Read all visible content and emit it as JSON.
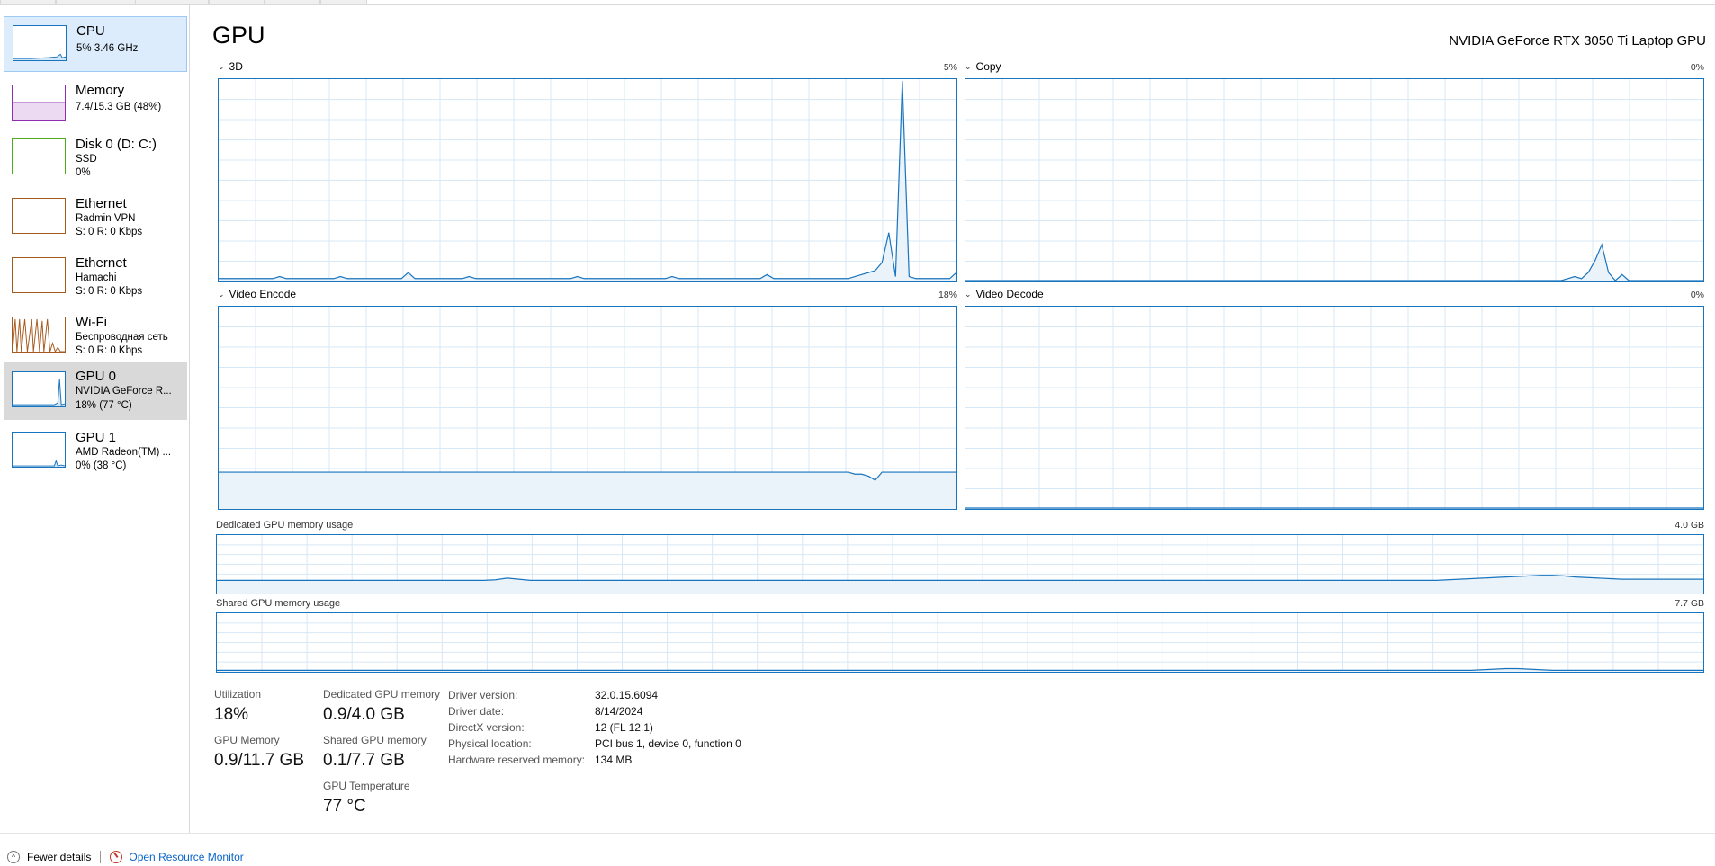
{
  "sidebar": {
    "items": [
      {
        "title": "CPU",
        "sub1": "5% 3.46 GHz",
        "sub2": "",
        "color": "#1874bd"
      },
      {
        "title": "Memory",
        "sub1": "7.4/15.3 GB (48%)",
        "sub2": "",
        "color": "#8e2fb3"
      },
      {
        "title": "Disk 0 (D: C:)",
        "sub1": "SSD",
        "sub2": "0%",
        "color": "#4eab1d"
      },
      {
        "title": "Ethernet",
        "sub1": "Radmin VPN",
        "sub2": "S: 0 R: 0 Kbps",
        "color": "#a75a1e"
      },
      {
        "title": "Ethernet",
        "sub1": "Hamachi",
        "sub2": "S: 0 R: 0 Kbps",
        "color": "#a75a1e"
      },
      {
        "title": "Wi-Fi",
        "sub1": "Беспроводная сеть",
        "sub2": "S: 0 R: 0 Kbps",
        "color": "#a75a1e"
      },
      {
        "title": "GPU 0",
        "sub1": "NVIDIA GeForce R...",
        "sub2": "18% (77 °C)",
        "color": "#1874bd"
      },
      {
        "title": "GPU 1",
        "sub1": "AMD Radeon(TM) ...",
        "sub2": "0% (38 °C)",
        "color": "#1874bd"
      }
    ]
  },
  "header": {
    "title": "GPU",
    "device": "NVIDIA GeForce RTX 3050 Ti Laptop GPU"
  },
  "graphs": {
    "g3d": {
      "label": "3D",
      "pct": "5%"
    },
    "copy": {
      "label": "Copy",
      "pct": "0%"
    },
    "encode": {
      "label": "Video Encode",
      "pct": "18%"
    },
    "decode": {
      "label": "Video Decode",
      "pct": "0%"
    },
    "dedicated": {
      "label": "Dedicated GPU memory usage",
      "max": "4.0 GB"
    },
    "shared": {
      "label": "Shared GPU memory usage",
      "max": "7.7 GB"
    }
  },
  "stats": {
    "utilization_label": "Utilization",
    "utilization": "18%",
    "gpu_memory_label": "GPU Memory",
    "gpu_memory": "0.9/11.7 GB",
    "dedicated_label": "Dedicated GPU memory",
    "dedicated": "0.9/4.0 GB",
    "shared_label": "Shared GPU memory",
    "shared": "0.1/7.7 GB",
    "temp_label": "GPU Temperature",
    "temp": "77 °C"
  },
  "properties": [
    {
      "key": "Driver version:",
      "value": "32.0.15.6094"
    },
    {
      "key": "Driver date:",
      "value": "8/14/2024"
    },
    {
      "key": "DirectX version:",
      "value": "12 (FL 12.1)"
    },
    {
      "key": "Physical location:",
      "value": "PCI bus 1, device 0, function 0"
    },
    {
      "key": "Hardware reserved memory:",
      "value": "134 MB"
    }
  ],
  "footer": {
    "fewer_details": "Fewer details",
    "resource_monitor": "Open Resource Monitor"
  },
  "colors": {
    "accent": "#1874bd",
    "grid": "#d7e8f6",
    "fill": "#eaf2fa"
  },
  "series": {
    "g3d": [
      1,
      1,
      1,
      1,
      1,
      1,
      1,
      1,
      1,
      2,
      1,
      1,
      1,
      1,
      1,
      1,
      1,
      1,
      2,
      1,
      1,
      1,
      1,
      1,
      1,
      1,
      1,
      1,
      4,
      1,
      1,
      1,
      1,
      1,
      1,
      1,
      1,
      2,
      1,
      1,
      1,
      1,
      1,
      1,
      1,
      1,
      1,
      1,
      1,
      1,
      1,
      1,
      1,
      2,
      1,
      1,
      1,
      1,
      1,
      1,
      1,
      1,
      1,
      1,
      1,
      1,
      1,
      2,
      1,
      1,
      1,
      1,
      1,
      1,
      1,
      1,
      1,
      1,
      1,
      1,
      1,
      3,
      1,
      1,
      1,
      1,
      1,
      1,
      1,
      1,
      1,
      1,
      1,
      1,
      2,
      3,
      4,
      5,
      9,
      24,
      2,
      100,
      2,
      1,
      1,
      1,
      1,
      1,
      1,
      4
    ],
    "copy": [
      0,
      0,
      0,
      0,
      0,
      0,
      0,
      0,
      0,
      0,
      0,
      0,
      0,
      0,
      0,
      0,
      0,
      0,
      0,
      0,
      0,
      0,
      0,
      0,
      0,
      0,
      0,
      0,
      0,
      0,
      0,
      0,
      0,
      0,
      0,
      0,
      0,
      0,
      0,
      0,
      0,
      0,
      0,
      0,
      0,
      0,
      0,
      0,
      0,
      0,
      0,
      0,
      0,
      0,
      0,
      0,
      0,
      0,
      0,
      0,
      0,
      0,
      0,
      0,
      0,
      0,
      0,
      0,
      0,
      0,
      0,
      0,
      0,
      0,
      0,
      0,
      0,
      0,
      0,
      0,
      0,
      0,
      0,
      0,
      0,
      0,
      0,
      0,
      0,
      1,
      2,
      1,
      4,
      10,
      18,
      4,
      0,
      3,
      0,
      0,
      0,
      0,
      0,
      0,
      0,
      0,
      0,
      0,
      0,
      0
    ],
    "encode": [
      18,
      18,
      18,
      18,
      18,
      18,
      18,
      18,
      18,
      18,
      18,
      18,
      18,
      18,
      18,
      18,
      18,
      18,
      18,
      18,
      18,
      18,
      18,
      18,
      18,
      18,
      18,
      18,
      18,
      18,
      18,
      18,
      18,
      18,
      18,
      18,
      18,
      18,
      18,
      18,
      18,
      18,
      18,
      18,
      18,
      18,
      18,
      18,
      18,
      18,
      18,
      18,
      18,
      18,
      18,
      18,
      18,
      18,
      18,
      18,
      18,
      18,
      18,
      18,
      18,
      18,
      18,
      18,
      18,
      18,
      18,
      18,
      18,
      18,
      18,
      18,
      18,
      18,
      18,
      18,
      18,
      18,
      18,
      18,
      18,
      18,
      18,
      18,
      18,
      18,
      18,
      18,
      18,
      18,
      17,
      17,
      16,
      14,
      18,
      18,
      18,
      18,
      18,
      18,
      18,
      18,
      18,
      18,
      18,
      18
    ],
    "decode": [
      0
    ],
    "dedicated": [
      22,
      22,
      22,
      22,
      22,
      22,
      22,
      22,
      22,
      22,
      22,
      22,
      22,
      22,
      22,
      22,
      22,
      22,
      22,
      22,
      22,
      22,
      22,
      22,
      23,
      26,
      24,
      22,
      22,
      22,
      22,
      22,
      22,
      22,
      22,
      22,
      22,
      22,
      22,
      22,
      22,
      22,
      22,
      22,
      22,
      22,
      22,
      22,
      22,
      22,
      22,
      22,
      22,
      22,
      22,
      22,
      22,
      22,
      22,
      22,
      22,
      22,
      22,
      22,
      22,
      22,
      22,
      22,
      22,
      22,
      22,
      22,
      22,
      22,
      22,
      22,
      22,
      22,
      22,
      22,
      22,
      22,
      22,
      22,
      22,
      22,
      22,
      22,
      22,
      22,
      22,
      22,
      22,
      22,
      22,
      22,
      22,
      22,
      22,
      22,
      22,
      22,
      22,
      22,
      22,
      22,
      23,
      24,
      25,
      26,
      27,
      28,
      29,
      30,
      31,
      31,
      30,
      28,
      27,
      26,
      25,
      24,
      24,
      24,
      24,
      24,
      24,
      24,
      24
    ],
    "shared": [
      1,
      1,
      1,
      1,
      1,
      1,
      1,
      1,
      1,
      1,
      1,
      1,
      1,
      1,
      1,
      1,
      1,
      1,
      1,
      1,
      1,
      1,
      1,
      1,
      1,
      1,
      1,
      1,
      1,
      1,
      1,
      1,
      1,
      1,
      1,
      1,
      1,
      1,
      1,
      1,
      1,
      1,
      1,
      1,
      1,
      1,
      1,
      1,
      1,
      1,
      1,
      1,
      1,
      1,
      1,
      1,
      1,
      1,
      1,
      1,
      1,
      1,
      1,
      1,
      1,
      1,
      1,
      1,
      1,
      1,
      1,
      1,
      1,
      1,
      1,
      1,
      1,
      1,
      1,
      1,
      1,
      1,
      1,
      1,
      1,
      1,
      1,
      1,
      1,
      1,
      1,
      1,
      1,
      1,
      1,
      1,
      1,
      1,
      1,
      1,
      1,
      1,
      1,
      1,
      1,
      1,
      1,
      1,
      1,
      2,
      3,
      4,
      4,
      3,
      2,
      1,
      1,
      1,
      1,
      1,
      1,
      1,
      1,
      1,
      1,
      1,
      1,
      1,
      1
    ]
  }
}
